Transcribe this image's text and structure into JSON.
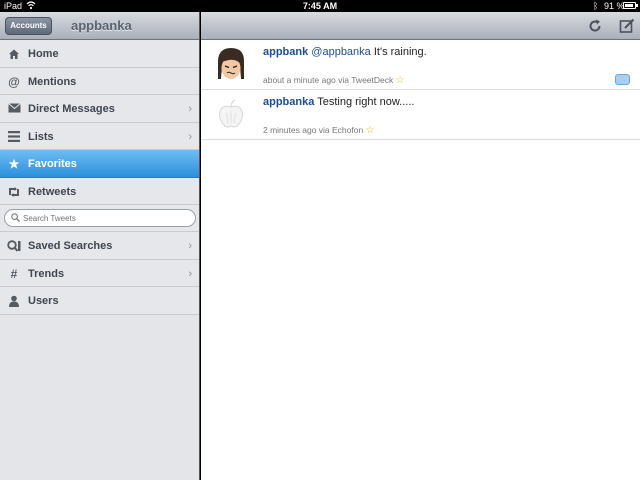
{
  "statusbar": {
    "device": "iPad",
    "time": "7:45 AM",
    "battery_text": "91 %",
    "battery_level": 0.91
  },
  "sidebar": {
    "accounts_label": "Accounts",
    "title": "appbanka",
    "items": [
      {
        "label": "Home",
        "icon": "home-icon",
        "chevron": false,
        "active": false
      },
      {
        "label": "Mentions",
        "icon": "at-icon",
        "chevron": false,
        "active": false
      },
      {
        "label": "Direct Messages",
        "icon": "envelope-icon",
        "chevron": true,
        "active": false
      },
      {
        "label": "Lists",
        "icon": "list-icon",
        "chevron": true,
        "active": false
      },
      {
        "label": "Favorites",
        "icon": "star-icon",
        "chevron": false,
        "active": true
      },
      {
        "label": "Retweets",
        "icon": "retweet-icon",
        "chevron": false,
        "active": false
      }
    ],
    "search_placeholder": "Search Tweets",
    "items2": [
      {
        "label": "Saved Searches",
        "icon": "saved-search-icon",
        "chevron": true
      },
      {
        "label": "Trends",
        "icon": "hash-icon",
        "chevron": true
      },
      {
        "label": "Users",
        "icon": "user-icon",
        "chevron": false
      }
    ]
  },
  "main": {
    "tweets": [
      {
        "user": "appbank",
        "mention": "@appbanka",
        "text": "It's raining.",
        "time": "about a minute ago via TweetDeck"
      },
      {
        "user": "appbanka",
        "mention": "",
        "text": "Testing right now.....",
        "time": "2 minutes ago via Echofon"
      }
    ]
  },
  "colors": {
    "active_blue": "#2c8fdc",
    "username_blue": "#1f4d8c",
    "star_yellow": "#e3c021"
  }
}
